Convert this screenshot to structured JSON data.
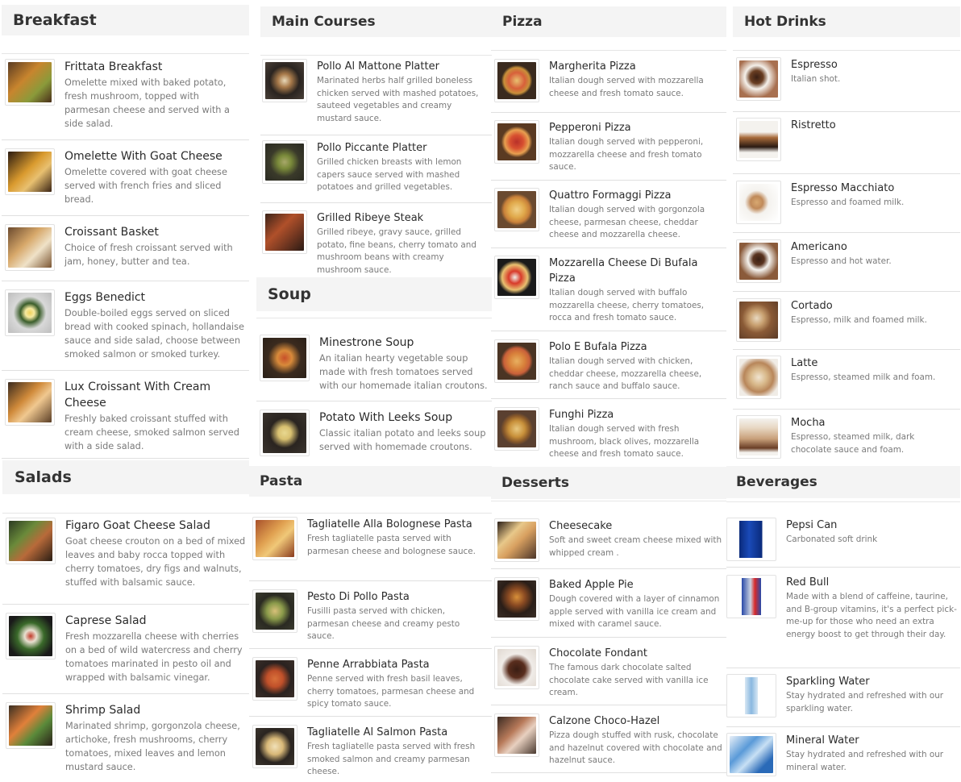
{
  "sections": {
    "breakfast": {
      "title": "Breakfast",
      "items": [
        {
          "name": "Frittata Breakfast",
          "desc": "Omelette mixed with baked potato, fresh mushroom, topped with parmesan cheese and served with a side salad."
        },
        {
          "name": "Omelette With Goat Cheese",
          "desc": "Omelette covered with goat cheese served with french fries and sliced bread."
        },
        {
          "name": "Croissant Basket",
          "desc": "Choice of fresh croissant served with jam, honey, butter and tea."
        },
        {
          "name": "Eggs Benedict",
          "desc": "Double-boiled eggs served on sliced bread with cooked spinach, hollandaise sauce and side salad, choose between smoked salmon or smoked turkey."
        },
        {
          "name": "Lux Croissant With Cream Cheese",
          "desc": "Freshly baked croissant stuffed with cream cheese, smoked salmon served with a side salad."
        }
      ]
    },
    "salads": {
      "title": "Salads",
      "items": [
        {
          "name": "Figaro Goat Cheese Salad",
          "desc": "Goat cheese crouton on a bed of mixed leaves and baby rocca topped with cherry tomatoes, dry figs and walnuts, stuffed with balsamic sauce."
        },
        {
          "name": "Caprese Salad",
          "desc": "Fresh mozzarella cheese with cherries on a bed of wild watercress and cherry tomatoes marinated in pesto oil and wrapped with balsamic vinegar."
        },
        {
          "name": "Shrimp Salad",
          "desc": "Marinated shrimp, gorgonzola cheese, artichoke, fresh mushrooms, cherry tomatoes, mixed leaves and lemon mustard sauce."
        }
      ]
    },
    "main_courses": {
      "title": "Main Courses",
      "items": [
        {
          "name": "Pollo Al Mattone Platter",
          "desc": "Marinated herbs half grilled boneless chicken served with mashed potatoes, sauteed vegetables and creamy mustard sauce."
        },
        {
          "name": "Pollo Piccante Platter",
          "desc": "Grilled chicken breasts with lemon capers sauce served with mashed potatoes and grilled vegetables."
        },
        {
          "name": "Grilled Ribeye Steak",
          "desc": "Grilled ribeye, gravy sauce, grilled potato, fine beans, cherry tomato and mushroom beans with creamy mushroom sauce."
        }
      ]
    },
    "soup": {
      "title": "Soup",
      "items": [
        {
          "name": "Minestrone Soup",
          "desc": "An italian hearty vegetable soup made with fresh tomatoes served with our homemade italian croutons."
        },
        {
          "name": "Potato With Leeks Soup",
          "desc": "Classic italian potato and leeks soup served with homemade croutons."
        }
      ]
    },
    "pasta": {
      "title": "Pasta",
      "items": [
        {
          "name": "Tagliatelle Alla Bolognese Pasta",
          "desc": "Fresh tagliatelle pasta served with parmesan cheese and bolognese sauce."
        },
        {
          "name": "Pesto Di Pollo Pasta",
          "desc": "Fusilli pasta served with chicken, parmesan cheese and creamy pesto sauce."
        },
        {
          "name": "Penne Arrabbiata Pasta",
          "desc": "Penne served with fresh basil leaves, cherry tomatoes, parmesan cheese and spicy tomato sauce."
        },
        {
          "name": "Tagliatelle Al Salmon Pasta",
          "desc": "Fresh tagliatelle pasta served with fresh smoked salmon and creamy parmesan cheese."
        }
      ]
    },
    "pizza": {
      "title": "Pizza",
      "items": [
        {
          "name": "Margherita Pizza",
          "desc": "Italian dough served with mozzarella cheese and fresh tomato sauce."
        },
        {
          "name": "Pepperoni Pizza",
          "desc": "Italian dough served with pepperoni, mozzarella cheese and fresh tomato sauce."
        },
        {
          "name": "Quattro Formaggi Pizza",
          "desc": "Italian dough served with gorgonzola cheese, parmesan cheese, cheddar cheese and mozzarella cheese."
        },
        {
          "name": "Mozzarella Cheese Di Bufala Pizza",
          "desc": "Italian dough served with buffalo mozzarella cheese, cherry tomatoes, rocca and fresh tomato sauce."
        },
        {
          "name": "Polo E Bufala Pizza",
          "desc": "Italian dough served with chicken, cheddar cheese, mozzarella cheese, ranch sauce and buffalo sauce."
        },
        {
          "name": "Funghi Pizza",
          "desc": "Italian dough served with fresh mushroom, black olives, mozzarella cheese and fresh tomato sauce."
        }
      ]
    },
    "desserts": {
      "title": "Desserts",
      "items": [
        {
          "name": "Cheesecake",
          "desc": "Soft and sweet cream cheese mixed with whipped cream ."
        },
        {
          "name": "Baked Apple Pie",
          "desc": "Dough covered with a layer of cinnamon apple served with vanilla ice cream and mixed with caramel sauce."
        },
        {
          "name": "Chocolate Fondant",
          "desc": "The famous dark chocolate salted chocolate cake served with vanilla ice cream."
        },
        {
          "name": "Calzone Choco-Hazel",
          "desc": "Pizza dough stuffed with rusk, chocolate and hazelnut covered with chocolate and hazelnut sauce."
        }
      ]
    },
    "hot_drinks": {
      "title": "Hot Drinks",
      "items": [
        {
          "name": "Espresso",
          "desc": "Italian shot."
        },
        {
          "name": "Ristretto",
          "desc": ""
        },
        {
          "name": "Espresso Macchiato",
          "desc": "Espresso and foamed milk."
        },
        {
          "name": "Americano",
          "desc": "Espresso and hot water."
        },
        {
          "name": "Cortado",
          "desc": "Espresso, milk and foamed milk."
        },
        {
          "name": "Latte",
          "desc": "Espresso, steamed milk and foam."
        },
        {
          "name": "Mocha",
          "desc": "Espresso, steamed milk, dark chocolate sauce and foam."
        }
      ]
    },
    "beverages": {
      "title": "Beverages",
      "items": [
        {
          "name": "Pepsi Can",
          "desc": "Carbonated soft drink"
        },
        {
          "name": "Red Bull",
          "desc": "Made with a blend of caffeine, taurine, and B-group vitamins, it's a perfect pick-me-up for those who need an extra energy boost to get through their day."
        },
        {
          "name": "Sparkling Water",
          "desc": "Stay hydrated and refreshed with our sparkling water."
        },
        {
          "name": "Mineral Water",
          "desc": "Stay hydrated and refreshed with our mineral water."
        }
      ]
    }
  }
}
